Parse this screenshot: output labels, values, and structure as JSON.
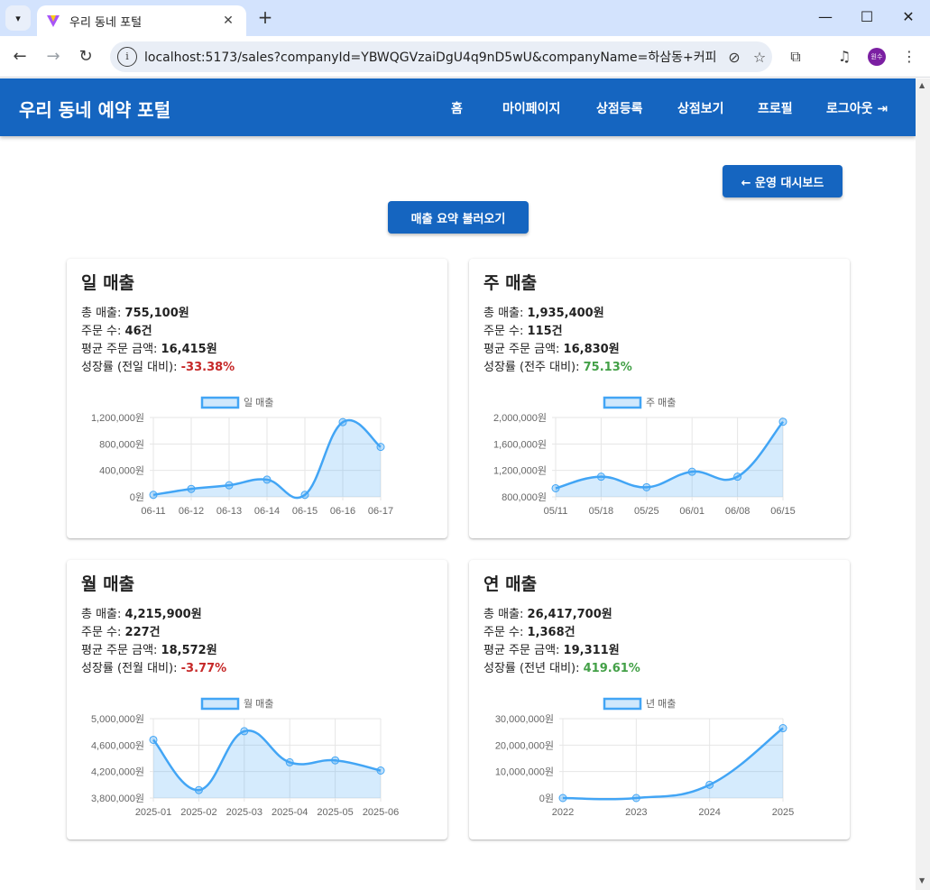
{
  "browser": {
    "tab_title": "우리 동네 포털",
    "url": "localhost:5173/sales?companyId=YBWQGVzaiDgU4q9nD5wU&companyName=하삼동+커피",
    "profile_initials": "원수"
  },
  "app": {
    "title": "우리 동네 예약 포털",
    "nav": [
      "홈",
      "마이페이지",
      "상점등록",
      "상점보기",
      "프로필",
      "로그아웃"
    ],
    "back_button": "← 운영 대시보드",
    "load_button": "매출 요약 불러오기",
    "accent_color": "#1565c0"
  },
  "labels": {
    "total_sales": "총 매출: ",
    "order_count": "주문 수: ",
    "avg_order": "평균 주문 금액: "
  },
  "cards": [
    {
      "title": "일 매출",
      "total": "755,100원",
      "orders": "46건",
      "avg": "16,415원",
      "growth_label": "성장률 (전일 대비): ",
      "growth": "-33.38%",
      "growth_positive": false
    },
    {
      "title": "주 매출",
      "total": "1,935,400원",
      "orders": "115건",
      "avg": "16,830원",
      "growth_label": "성장률 (전주 대비): ",
      "growth": "75.13%",
      "growth_positive": true
    },
    {
      "title": "월 매출",
      "total": "4,215,900원",
      "orders": "227건",
      "avg": "18,572원",
      "growth_label": "성장률 (전월 대비): ",
      "growth": "-3.77%",
      "growth_positive": false
    },
    {
      "title": "연 매출",
      "total": "26,417,700원",
      "orders": "1,368건",
      "avg": "19,311원",
      "growth_label": "성장률 (전년 대비): ",
      "growth": "419.61%",
      "growth_positive": true
    }
  ],
  "chart_data": [
    {
      "type": "area",
      "series": [
        {
          "name": "일 매출",
          "values": [
            30000,
            120000,
            175000,
            260000,
            30000,
            1130000,
            755100
          ]
        }
      ],
      "categories": [
        "06-11",
        "06-12",
        "06-13",
        "06-14",
        "06-15",
        "06-16",
        "06-17"
      ],
      "ylim": [
        0,
        1200000
      ],
      "yticks": [
        "1,200,000원",
        "800,000원",
        "400,000원",
        "0원"
      ],
      "grid": true,
      "legend": "top",
      "color": "#42a5f5"
    },
    {
      "type": "area",
      "series": [
        {
          "name": "주 매출",
          "values": [
            930000,
            1105000,
            945000,
            1180000,
            1105000,
            1935400
          ]
        }
      ],
      "categories": [
        "05/11",
        "05/18",
        "05/25",
        "06/01",
        "06/08",
        "06/15"
      ],
      "ylim": [
        800000,
        2000000
      ],
      "yticks": [
        "2,000,000원",
        "1,600,000원",
        "1,200,000원",
        "800,000원"
      ],
      "grid": true,
      "legend": "top",
      "color": "#42a5f5"
    },
    {
      "type": "area",
      "series": [
        {
          "name": "월 매출",
          "values": [
            4680000,
            3920000,
            4810000,
            4340000,
            4370000,
            4215900
          ]
        }
      ],
      "categories": [
        "2025-01",
        "2025-02",
        "2025-03",
        "2025-04",
        "2025-05",
        "2025-06"
      ],
      "ylim": [
        3800000,
        5000000
      ],
      "yticks": [
        "5,000,000원",
        "4,600,000원",
        "4,200,000원",
        "3,800,000원"
      ],
      "grid": true,
      "legend": "top",
      "color": "#42a5f5"
    },
    {
      "type": "area",
      "series": [
        {
          "name": "년 매출",
          "values": [
            0,
            0,
            5000000,
            26417700
          ]
        }
      ],
      "categories": [
        "2022",
        "2023",
        "2024",
        "2025"
      ],
      "ylim": [
        0,
        30000000
      ],
      "yticks": [
        "30,000,000원",
        "20,000,000원",
        "10,000,000원",
        "0원"
      ],
      "grid": true,
      "legend": "top",
      "color": "#42a5f5"
    }
  ]
}
